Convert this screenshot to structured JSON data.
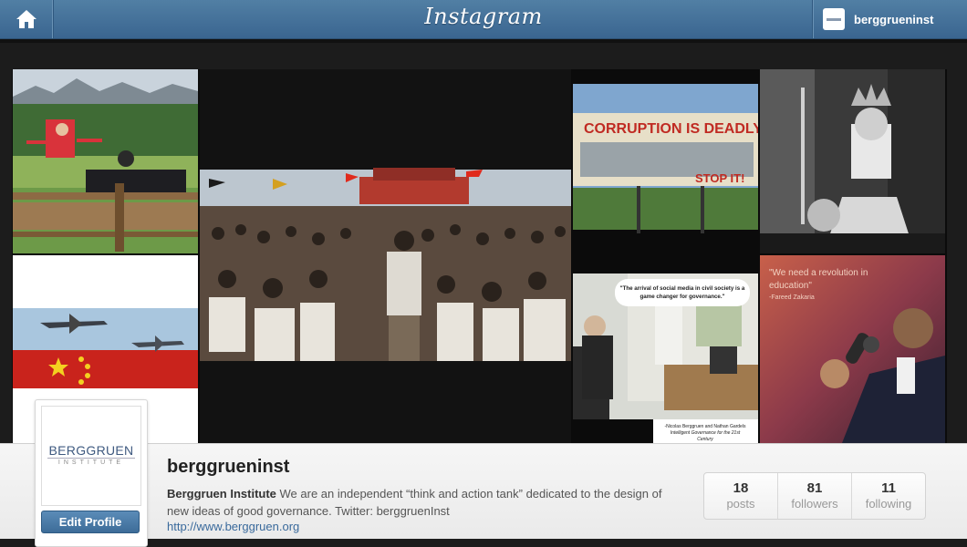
{
  "header": {
    "logo": "Instagram",
    "username": "berggrueninst"
  },
  "photos": [
    {
      "description": "Two leaders on a wooden bench in an alpine meadow"
    },
    {
      "description": "Large crowd sitting in a city square with red flags"
    },
    {
      "description": "Billboard reading CORRUPTION IS DEADLY STOP IT",
      "text": [
        "CORRUPTION IS DEADLY",
        "STOP IT!"
      ]
    },
    {
      "description": "Black and white portrait of a queen wearing a crown"
    },
    {
      "description": "Two aircraft flying over a red flag with yellow stars"
    },
    {
      "description": "Man photographing a meeting room",
      "text": [
        "\"The arrival of social media in civil society is a game changer for governance.\"",
        "-Nicolas Berggruen and Nathan Gardels Intelligent Governance for the 21st Century"
      ]
    },
    {
      "description": "Speaker holding a microphone",
      "text": [
        "\"We need a revolution in education\"",
        "-Fareed Zakaria"
      ]
    }
  ],
  "profile": {
    "avatar_title": "BERGGRUEN",
    "avatar_subtitle": "INSTITUTE",
    "edit_button": "Edit Profile",
    "username": "berggrueninst",
    "bio_name": "Berggruen Institute",
    "bio_text": " We are an independent “think and action tank” dedicated to the design of new ideas of good governance. Twitter: berggruenInst",
    "url": "http://www.berggruen.org",
    "stats": [
      {
        "count": "18",
        "label": "posts"
      },
      {
        "count": "81",
        "label": "followers"
      },
      {
        "count": "11",
        "label": "following"
      }
    ]
  },
  "colors": {
    "topbar": "#3f6b95",
    "button": "#4a7aa8",
    "link": "#3a6a9c"
  }
}
